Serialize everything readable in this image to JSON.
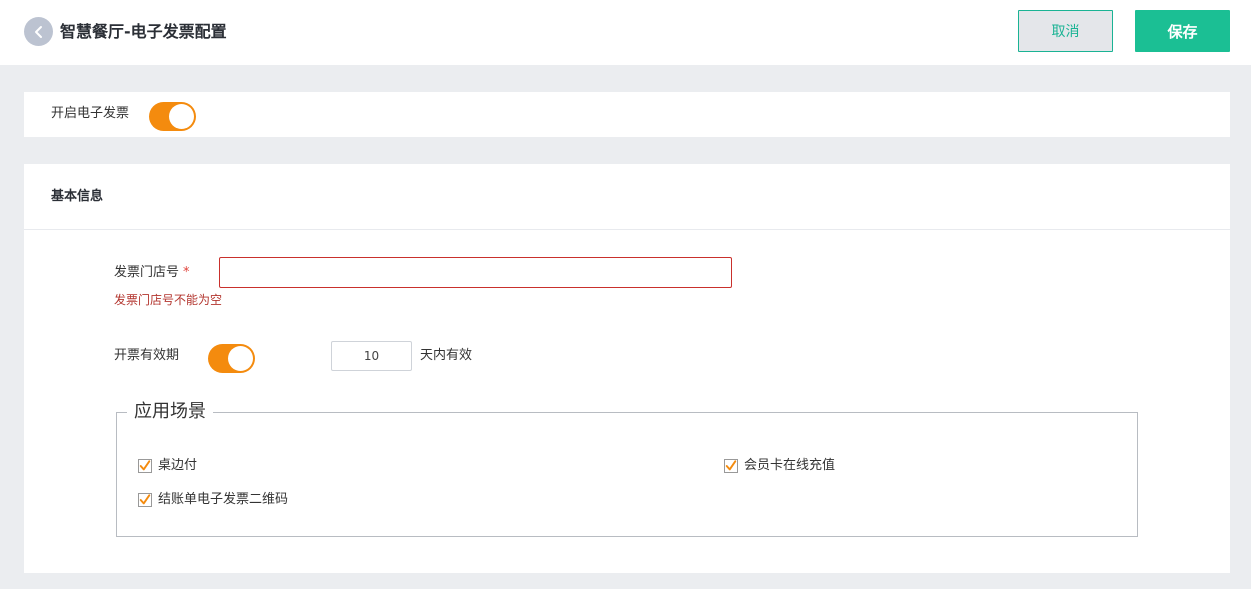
{
  "header": {
    "title": "智慧餐厅-电子发票配置",
    "cancel_label": "取消",
    "save_label": "保存"
  },
  "enable": {
    "label": "开启电子发票",
    "checked": true
  },
  "basic_info": {
    "title": "基本信息",
    "store_no": {
      "label": "发票门店号",
      "required_mark": "*",
      "value": "",
      "error": "发票门店号不能为空"
    },
    "validity": {
      "label": "开票有效期",
      "checked": true,
      "days_value": "10",
      "suffix": "天内有效"
    }
  },
  "scenarios": {
    "legend": "应用场景",
    "items": [
      {
        "label": "桌边付",
        "checked": true
      },
      {
        "label": "会员卡在线充值",
        "checked": true
      },
      {
        "label": "结账单电子发票二维码",
        "checked": true
      }
    ]
  },
  "colors": {
    "accent": "#1bbf94",
    "toggle_on": "#f48b0e",
    "error": "#b3362f",
    "checkbox_check": "#f48b0e"
  }
}
